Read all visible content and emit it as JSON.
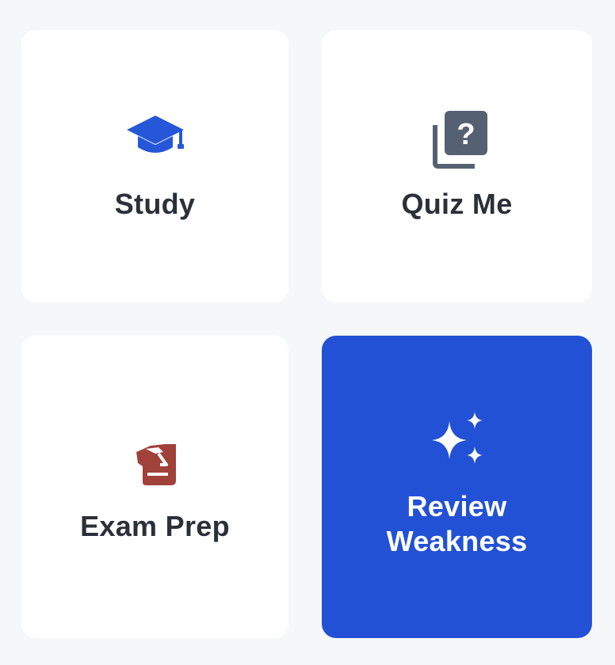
{
  "tiles": [
    {
      "label": "Study",
      "icon": "graduation-cap-icon",
      "icon_color": "#2557d8",
      "selected": false
    },
    {
      "label": "Quiz Me",
      "icon": "question-cards-icon",
      "icon_color": "#556173",
      "selected": false
    },
    {
      "label": "Exam Prep",
      "icon": "exam-scroll-icon",
      "icon_color": "#a0413a",
      "selected": false
    },
    {
      "label": "Review\nWeakness",
      "icon": "sparkles-icon",
      "icon_color": "#ffffff",
      "selected": true
    }
  ],
  "colors": {
    "page_background": "#f6f7f9",
    "card_background": "#ffffff",
    "accent": "#2251d6",
    "text": "#2b3039"
  }
}
